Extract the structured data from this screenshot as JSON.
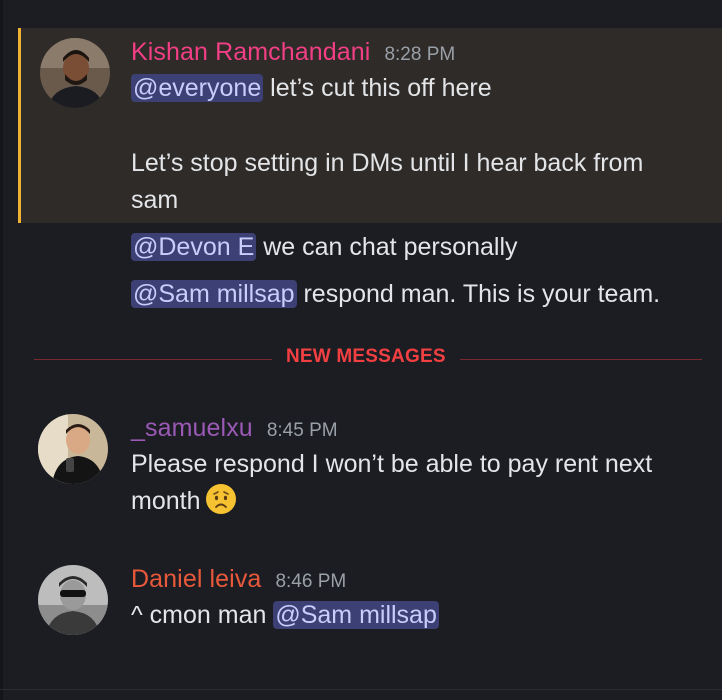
{
  "messages": [
    {
      "author": "Kishan Ramchandani",
      "author_color": "#f23f85",
      "time": "8:28 PM",
      "highlighted": true,
      "lines": [
        {
          "mention": "@everyone",
          "text": " let’s cut this off here"
        },
        {
          "text": "Let’s stop setting in DMs until I hear back from"
        },
        {
          "text": "sam"
        },
        {
          "mention": "@Devon E",
          "text": " we can chat personally"
        },
        {
          "mention": "@Sam millsap",
          "text": " respond man. This is your team."
        }
      ]
    },
    {
      "author": "_samuelxu",
      "author_color": "#9b59b6",
      "time": "8:45 PM",
      "lines": [
        {
          "text": "Please respond I won’t be able to pay rent next"
        },
        {
          "text": "month",
          "emoji": "worried-face"
        }
      ]
    },
    {
      "author": "Daniel leiva",
      "author_color": "#e8593c",
      "time": "8:46 PM",
      "lines": [
        {
          "text": "^ cmon man ",
          "mention": "@Sam millsap"
        }
      ]
    }
  ],
  "divider": {
    "label": "NEW MESSAGES",
    "color": "#f23f42"
  }
}
